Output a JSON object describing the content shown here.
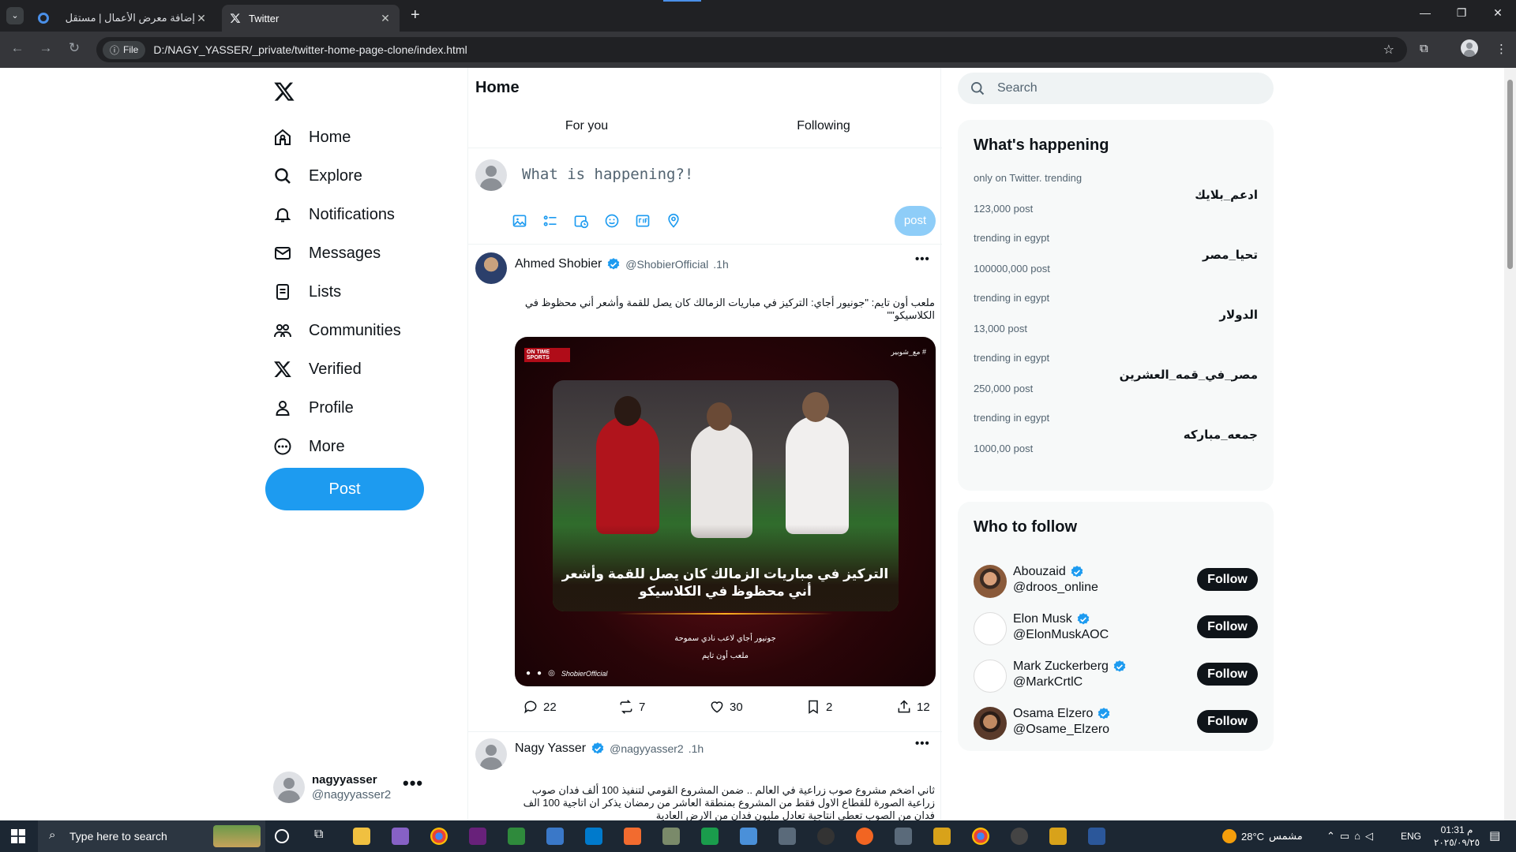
{
  "browser": {
    "tabs": [
      {
        "title": "إضافة معرض الأعمال | مستقل",
        "active": false
      },
      {
        "title": "Twitter",
        "active": true
      }
    ],
    "address": {
      "badge": "File",
      "url": "D:/NAGY_YASSER/_private/twitter-home-page-clone/index.html"
    }
  },
  "sidebar": {
    "items": [
      {
        "label": "Home",
        "icon": "home-icon"
      },
      {
        "label": "Explore",
        "icon": "search-icon"
      },
      {
        "label": "Notifications",
        "icon": "bell-icon"
      },
      {
        "label": "Messages",
        "icon": "mail-icon"
      },
      {
        "label": "Lists",
        "icon": "list-icon"
      },
      {
        "label": "Communities",
        "icon": "communities-icon"
      },
      {
        "label": "Verified",
        "icon": "x-logo-icon"
      },
      {
        "label": "Profile",
        "icon": "person-icon"
      },
      {
        "label": "More",
        "icon": "more-circle-icon"
      }
    ],
    "post_label": "Post",
    "user": {
      "name": "nagyyasser",
      "handle": "@nagyyasser2"
    }
  },
  "main": {
    "title": "Home",
    "tabs": [
      {
        "label": "For you"
      },
      {
        "label": "Following"
      }
    ],
    "compose": {
      "placeholder": "What is happening?!",
      "post_label": "post"
    },
    "tweets": [
      {
        "name": "Ahmed Shobier",
        "handle": "@ShobierOfficial",
        "time": ".1h",
        "text_line1": "ملعب أون تايم: \"جونيور أجاي: التركيز في مباريات الزمالك كان يصل للقمة وأشعر أني محظوظ في",
        "text_line2": "الكلاسيكو\"\"",
        "image": {
          "badge": "ON TIME SPORTS",
          "hashtag": "# مع_شوبير",
          "headline1": "التركيز في مباريات الزمالك كان يصل للقمة وأشعر",
          "headline2": "أني محظوظ في الكلاسيكو",
          "sub1": "جونيور أجاي لاعب نادي سموحة",
          "sub2": "ملعب أون تايم",
          "footer": "ShobierOfficial"
        },
        "stats": {
          "replies": "22",
          "retweets": "7",
          "likes": "30",
          "bookmarks": "2",
          "shares": "12"
        }
      },
      {
        "name": "Nagy Yasser",
        "handle": "@nagyyasser2",
        "time": ".1h",
        "text_line1": "ثاني اضخم مشروع صوب زراعية في العالم .. ضمن المشروع القومي لتنفيذ 100 ألف فدان صوب",
        "text_line2": "زراعية الصورة للقطاع الاول فقط من المشروع بمنطقة العاشر من رمضان يذكر ان اتاجية 100 الف",
        "text_line3": "فدان من الصوب تعطي انتاجية تعادل مليون فدان من الارض العادية"
      }
    ]
  },
  "right": {
    "search_placeholder": "Search",
    "trends_title": "What's happening",
    "trends": [
      {
        "category": "only on Twitter. trending",
        "tag": "ادعم_بلايك",
        "count": "123,000 post"
      },
      {
        "category": "trending in egypt",
        "tag": "تحيا_مصر",
        "count": "100000,000 post"
      },
      {
        "category": "trending in egypt",
        "tag": "الدولار",
        "count": "13,000 post"
      },
      {
        "category": "trending in egypt",
        "tag": "مصر_في_قمه_العشرين",
        "count": "250,000 post"
      },
      {
        "category": "trending in egypt",
        "tag": "جمعه_مباركه",
        "count": "1000,00 post"
      }
    ],
    "follow_title": "Who to follow",
    "follow": [
      {
        "name": "Abouzaid",
        "handle": "@droos_online",
        "button": "Follow"
      },
      {
        "name": "Elon Musk",
        "handle": "@ElonMuskAOC",
        "button": "Follow"
      },
      {
        "name": "Mark Zuckerberg",
        "handle": "@MarkCrtlC",
        "button": "Follow"
      },
      {
        "name": "Osama Elzero",
        "handle": "@Osame_Elzero",
        "button": "Follow"
      }
    ]
  },
  "taskbar": {
    "search_placeholder": "Type here to search",
    "weather": "28°C",
    "weather_label": "مشمس",
    "lang": "ENG",
    "time": "01:31 م",
    "date": "٢٠٢٥/٠٩/٢٥"
  },
  "colors": {
    "accent": "#1d9bf0",
    "verified": "#1d9bf0",
    "post_disabled": "#8ecdf8",
    "text": "#0f1419",
    "secondary": "#536471"
  }
}
